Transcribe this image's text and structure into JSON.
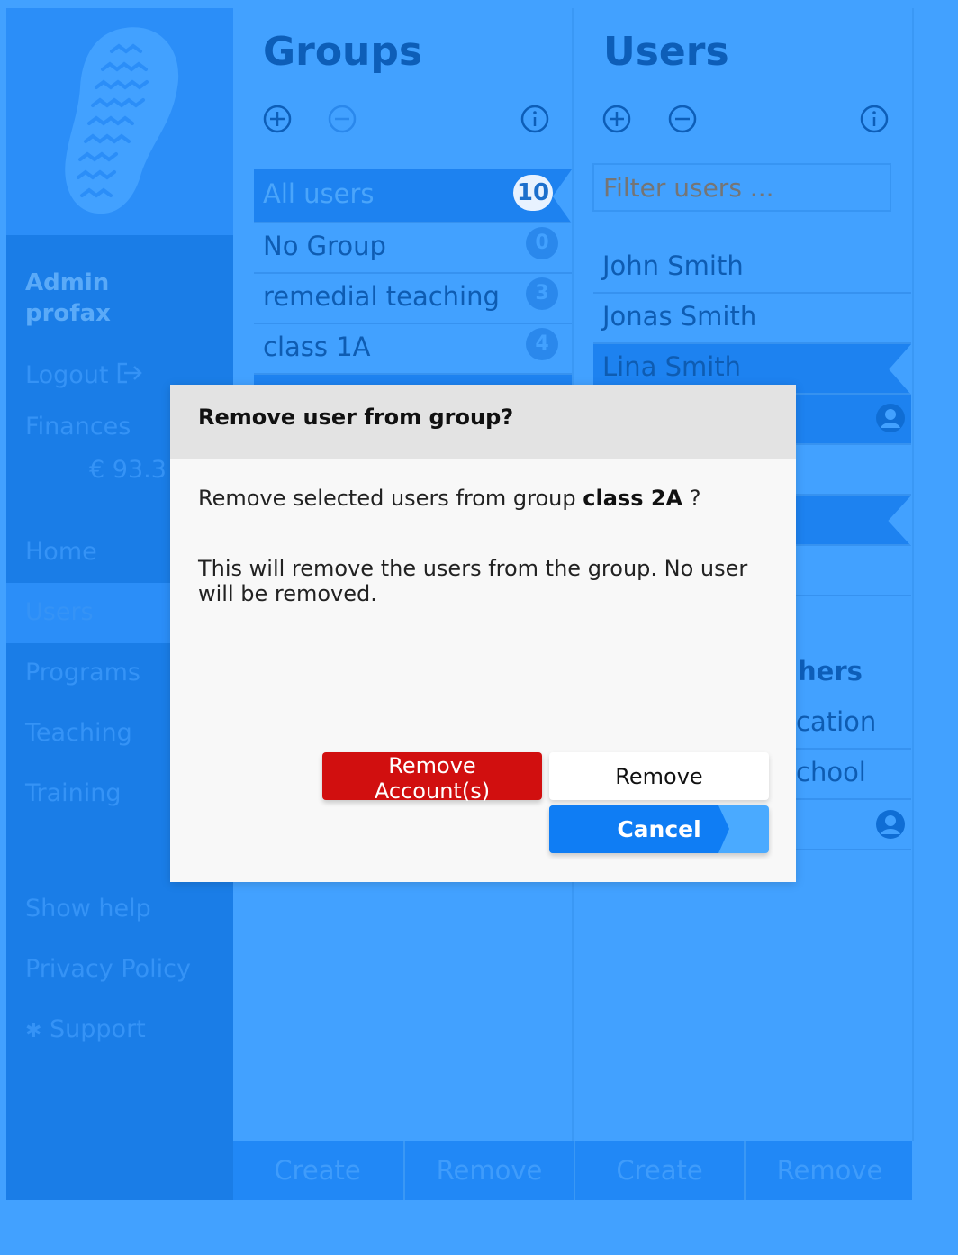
{
  "sidebar": {
    "admin_line1": "Admin",
    "admin_line2": "profax",
    "logout": "Logout",
    "finances": "Finances",
    "balance": "€ 93.3",
    "home": "Home",
    "users": "Users",
    "programs": "Programs",
    "teaching": "Teaching",
    "training": "Training",
    "show_help": "Show help",
    "privacy_policy": "Privacy Policy",
    "support": "Support"
  },
  "groups": {
    "title": "Groups",
    "items": [
      {
        "label": "All users",
        "count": "10"
      },
      {
        "label": "No Group",
        "count": "0"
      },
      {
        "label": "remedial teaching",
        "count": "3"
      },
      {
        "label": "class 1A",
        "count": "4"
      }
    ],
    "create": "Create",
    "remove": "Remove"
  },
  "users": {
    "title": "Users",
    "filter_placeholder": "Filter users ...",
    "items": [
      "John Smith",
      "Jonas Smith",
      "Lina Smith"
    ],
    "partial_header": "hers",
    "partial_1": "cation",
    "partial_2": "chool",
    "create": "Create",
    "remove": "Remove"
  },
  "dialog": {
    "title": "Remove user from group?",
    "msg_prefix": "Remove selected users from group ",
    "group_name": "class 2A",
    "msg_suffix": " ?",
    "description": "This will remove the users from the group. No user will be removed.",
    "remove_accounts": "Remove Account(s)",
    "remove": "Remove",
    "cancel": "Cancel"
  },
  "colors": {
    "background": "#42a1ff",
    "sidebar": "#1a7de7",
    "title": "#0d5eb8",
    "danger": "#d10f0f",
    "primary": "#0f7df4"
  }
}
